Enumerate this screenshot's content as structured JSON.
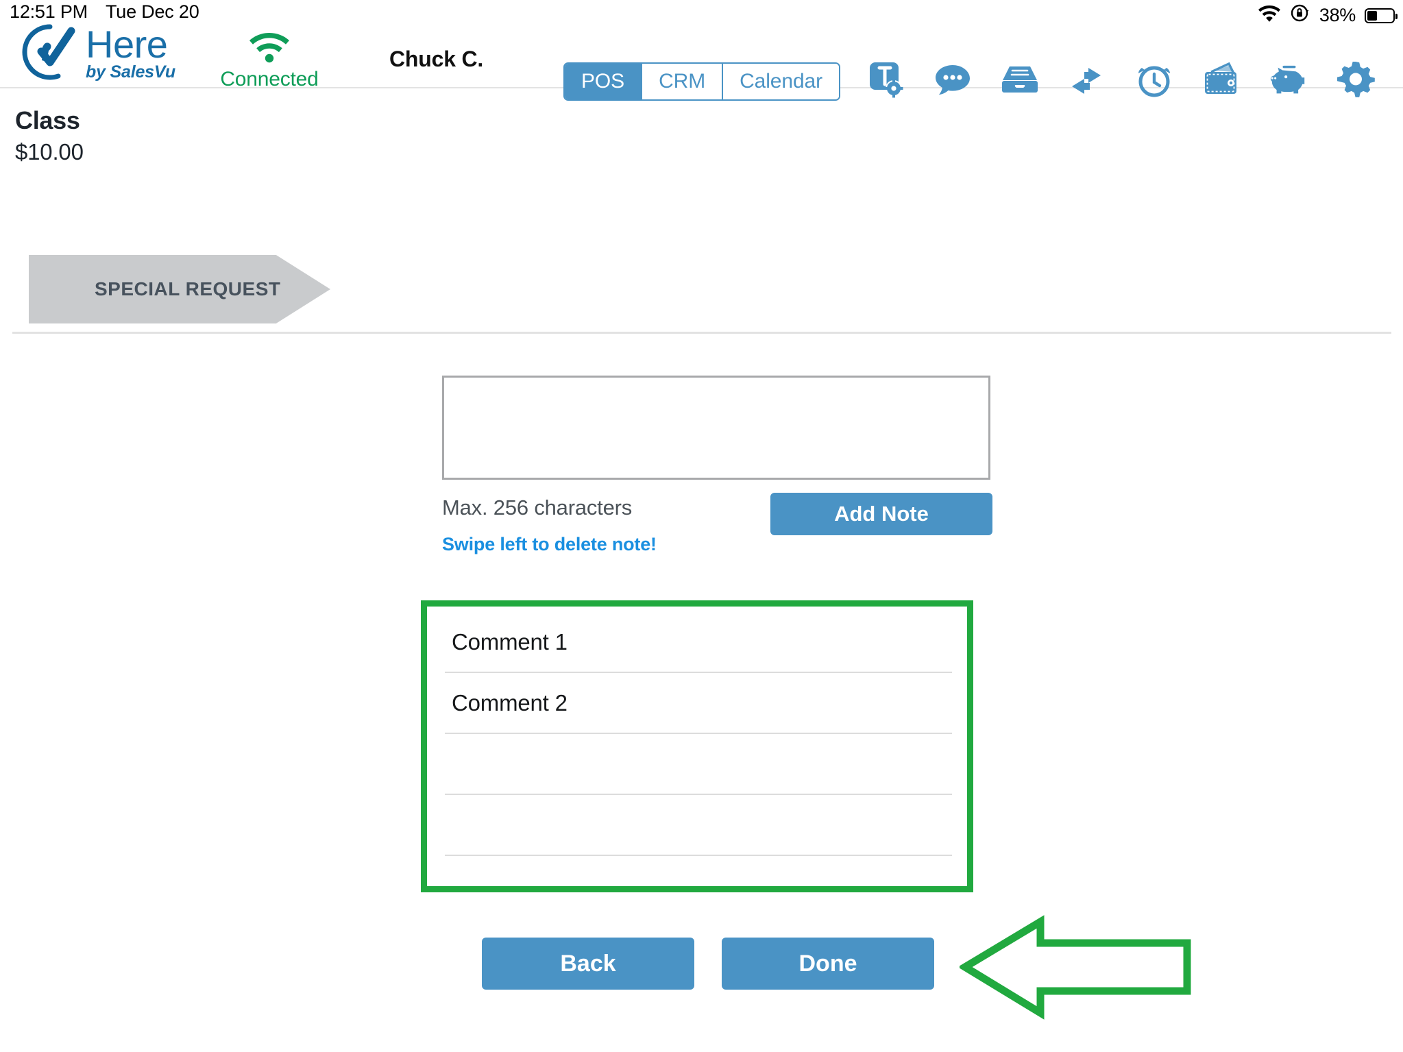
{
  "status_bar": {
    "time": "12:51 PM",
    "date": "Tue Dec 20",
    "wifi_icon": "wifi-icon",
    "rotation_lock_icon": "rotation-lock-icon",
    "battery_percent": "38%",
    "battery_icon": "battery-icon"
  },
  "header": {
    "logo": {
      "mark_icon": "here-checkmark-logo-icon",
      "name": "Here",
      "tagline": "by SalesVu"
    },
    "connection": {
      "icon": "wifi-signal-icon",
      "label": "Connected",
      "color": "#0f9d58"
    },
    "user": "Chuck C.",
    "accent_color": "#4a93c5",
    "tabs": [
      {
        "label": "POS",
        "active": true
      },
      {
        "label": "CRM",
        "active": false
      },
      {
        "label": "Calendar",
        "active": false
      }
    ],
    "icons": [
      {
        "name": "ticket-settings-icon",
        "title": "Tickets"
      },
      {
        "name": "chat-bubble-icon",
        "title": "Messages"
      },
      {
        "name": "file-drawer-icon",
        "title": "Drawer"
      },
      {
        "name": "exchange-arrows-icon",
        "title": "Exchange"
      },
      {
        "name": "alarm-clock-icon",
        "title": "Time Clock"
      },
      {
        "name": "wallet-cash-icon",
        "title": "Cash"
      },
      {
        "name": "piggy-bank-icon",
        "title": "Tips"
      },
      {
        "name": "gear-icon",
        "title": "Settings"
      },
      {
        "name": "logout-icon",
        "title": "Log Out"
      }
    ]
  },
  "product": {
    "title": "Class",
    "price": "$10.00"
  },
  "banner": {
    "label": "SPECIAL REQUEST",
    "background_color": "#c9cbcd",
    "text_color": "#47525d"
  },
  "note_entry": {
    "textarea_value": "",
    "textarea_placeholder": "",
    "max_chars_label": "Max. 256 characters",
    "swipe_hint": "Swipe left to delete note!",
    "swipe_hint_color": "#1a8fe0",
    "add_note_label": "Add Note"
  },
  "comments": {
    "highlight_color": "#21a93f",
    "rows": [
      {
        "text": "Comment 1"
      },
      {
        "text": "Comment 2"
      },
      {
        "text": ""
      },
      {
        "text": ""
      },
      {
        "text": ""
      }
    ]
  },
  "footer": {
    "back_label": "Back",
    "done_label": "Done"
  },
  "annotation": {
    "arrow_icon": "left-arrow-annotation-icon",
    "arrow_color": "#21a93f",
    "points_to": "Done"
  }
}
